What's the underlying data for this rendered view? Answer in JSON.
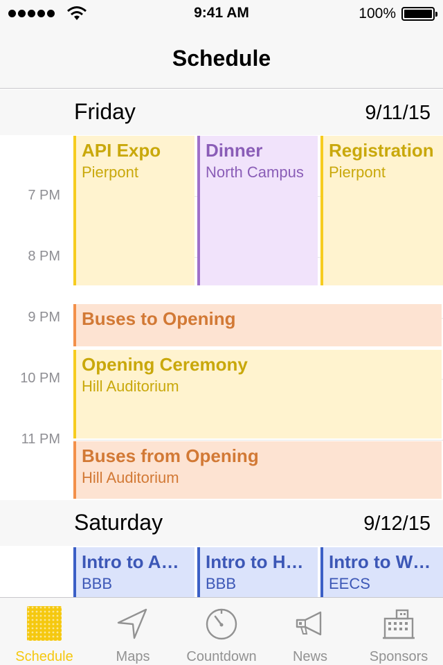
{
  "status_bar": {
    "time": "9:41 AM",
    "battery": "100%"
  },
  "nav": {
    "title": "Schedule"
  },
  "days": [
    {
      "name": "Friday",
      "date": "9/11/15"
    },
    {
      "name": "Saturday",
      "date": "9/12/15"
    }
  ],
  "hours": [
    "7 PM",
    "8 PM",
    "9 PM",
    "10 PM",
    "11 PM"
  ],
  "events": {
    "api_expo": {
      "title": "API Expo",
      "location": "Pierpont"
    },
    "dinner": {
      "title": "Dinner",
      "location": "North Campus"
    },
    "registration": {
      "title": "Registration",
      "location": "Pierpont"
    },
    "buses_to_opening": {
      "title": "Buses to Opening"
    },
    "opening_ceremony": {
      "title": "Opening Ceremony",
      "location": "Hill Auditorium"
    },
    "buses_from_opening": {
      "title": "Buses from Opening",
      "location": "Hill Auditorium"
    },
    "intro_a": {
      "title": "Intro to A…",
      "location": "BBB"
    },
    "intro_h": {
      "title": "Intro to H…",
      "location": "BBB"
    },
    "intro_w": {
      "title": "Intro to W…",
      "location": "EECS"
    }
  },
  "tabs": [
    {
      "label": "Schedule",
      "icon": "calendar-grid-icon",
      "active": true
    },
    {
      "label": "Maps",
      "icon": "location-arrow-icon",
      "active": false
    },
    {
      "label": "Countdown",
      "icon": "stopwatch-icon",
      "active": false
    },
    {
      "label": "News",
      "icon": "megaphone-icon",
      "active": false
    },
    {
      "label": "Sponsors",
      "icon": "building-icon",
      "active": false
    }
  ],
  "colors": {
    "accent": "#f5c80f",
    "inactive_tab": "#929292"
  }
}
